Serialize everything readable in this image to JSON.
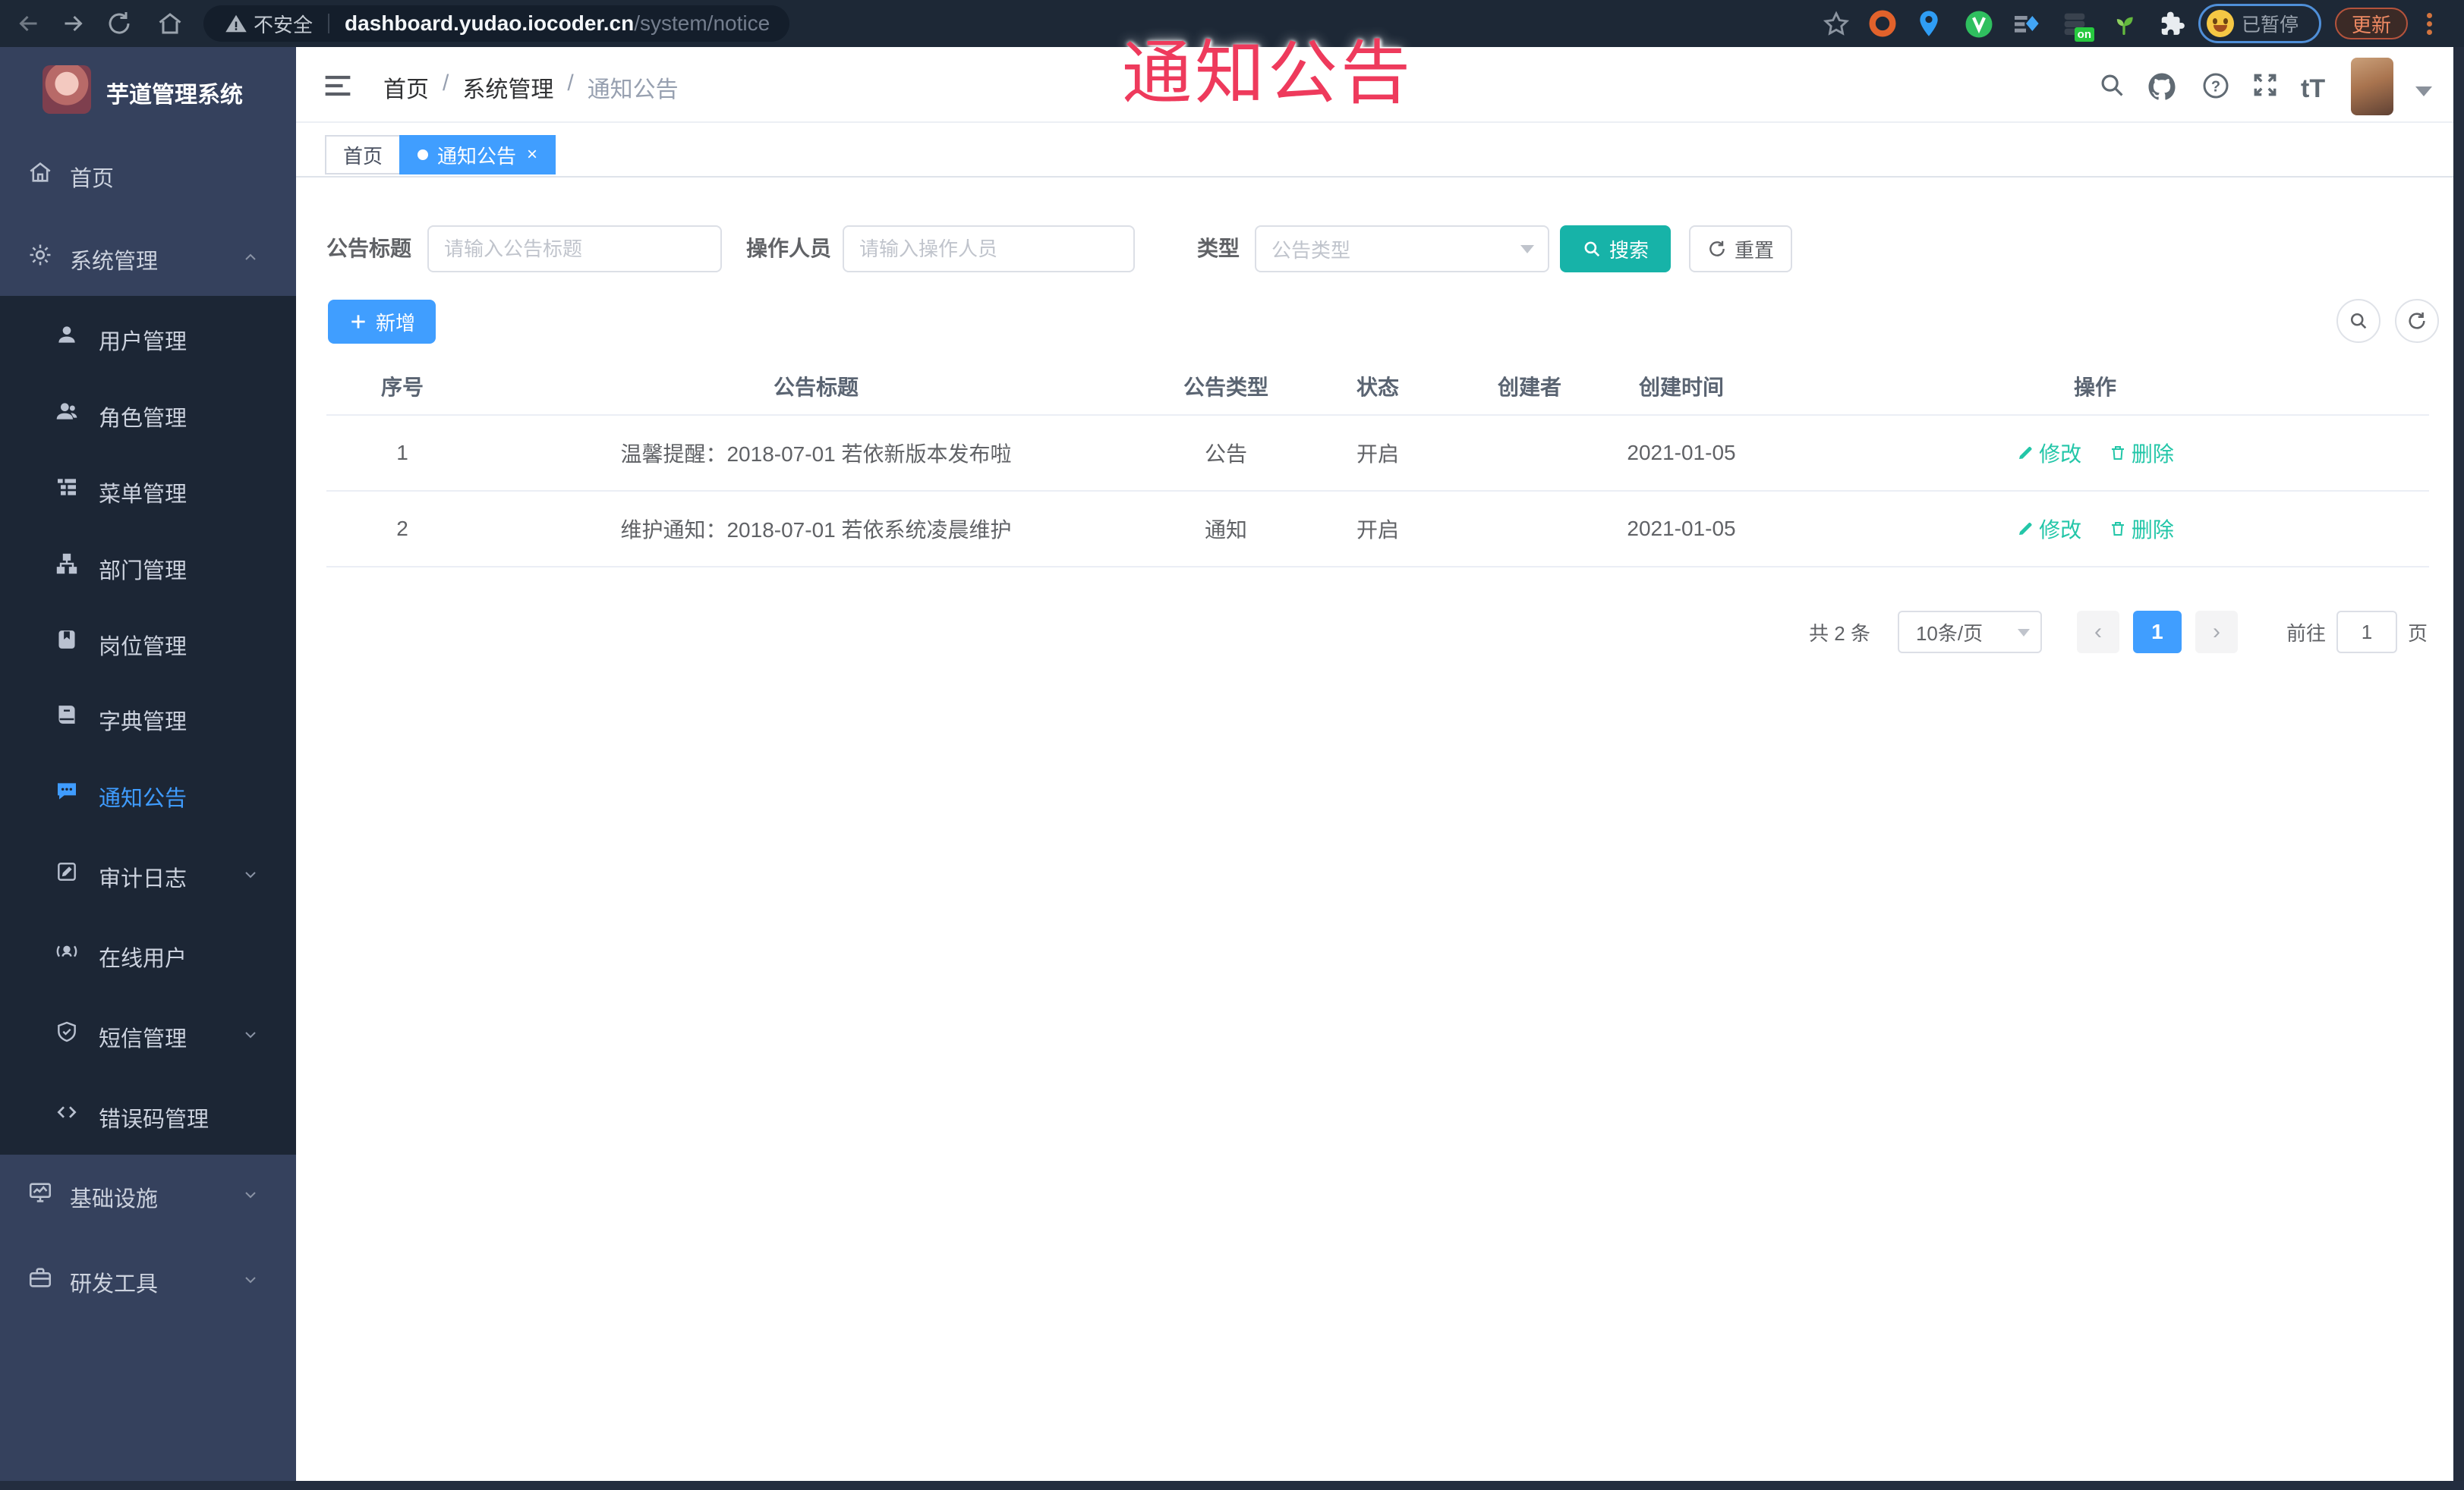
{
  "browser": {
    "security_label": "不安全",
    "url_host": "dashboard.yudao.iocoder.cn",
    "url_path": "/system/notice",
    "profile_status": "已暂停",
    "update_label": "更新",
    "extension_badge_on": "on"
  },
  "overlay_title": "通知公告",
  "sidebar": {
    "app_title": "芋道管理系统",
    "items": [
      {
        "label": "首页"
      },
      {
        "label": "系统管理"
      },
      {
        "label": "用户管理"
      },
      {
        "label": "角色管理"
      },
      {
        "label": "菜单管理"
      },
      {
        "label": "部门管理"
      },
      {
        "label": "岗位管理"
      },
      {
        "label": "字典管理"
      },
      {
        "label": "通知公告"
      },
      {
        "label": "审计日志"
      },
      {
        "label": "在线用户"
      },
      {
        "label": "短信管理"
      },
      {
        "label": "错误码管理"
      },
      {
        "label": "基础设施"
      },
      {
        "label": "研发工具"
      }
    ]
  },
  "navbar": {
    "breadcrumb": {
      "home": "首页",
      "section": "系统管理",
      "current": "通知公告",
      "separator": "/"
    },
    "font_icon_glyph": "tT"
  },
  "tabs": {
    "home": "首页",
    "current": "通知公告"
  },
  "filters": {
    "title_label": "公告标题",
    "title_placeholder": "请输入公告标题",
    "operator_label": "操作人员",
    "operator_placeholder": "请输入操作人员",
    "type_label": "类型",
    "type_placeholder": "公告类型",
    "search_label": "搜索",
    "reset_label": "重置"
  },
  "toolbar": {
    "add_label": "新增"
  },
  "table": {
    "headers": {
      "index": "序号",
      "title": "公告标题",
      "type": "公告类型",
      "status": "状态",
      "creator": "创建者",
      "created": "创建时间",
      "actions": "操作"
    },
    "rows": [
      {
        "index": "1",
        "title": "温馨提醒：2018-07-01 若依新版本发布啦",
        "type": "公告",
        "status": "开启",
        "creator": "",
        "created": "2021-01-05"
      },
      {
        "index": "2",
        "title": "维护通知：2018-07-01 若依系统凌晨维护",
        "type": "通知",
        "status": "开启",
        "creator": "",
        "created": "2021-01-05"
      }
    ],
    "edit_label": "修改",
    "delete_label": "删除"
  },
  "pagination": {
    "total": "共 2 条",
    "page_size": "10条/页",
    "current_page": "1",
    "goto_label": "前往",
    "goto_value": "1",
    "page_unit": "页"
  },
  "colors": {
    "primary": "#409eff",
    "search_teal": "#17b3a8",
    "action_green": "#23c6a8",
    "overlay_red": "#ee3a5c"
  }
}
